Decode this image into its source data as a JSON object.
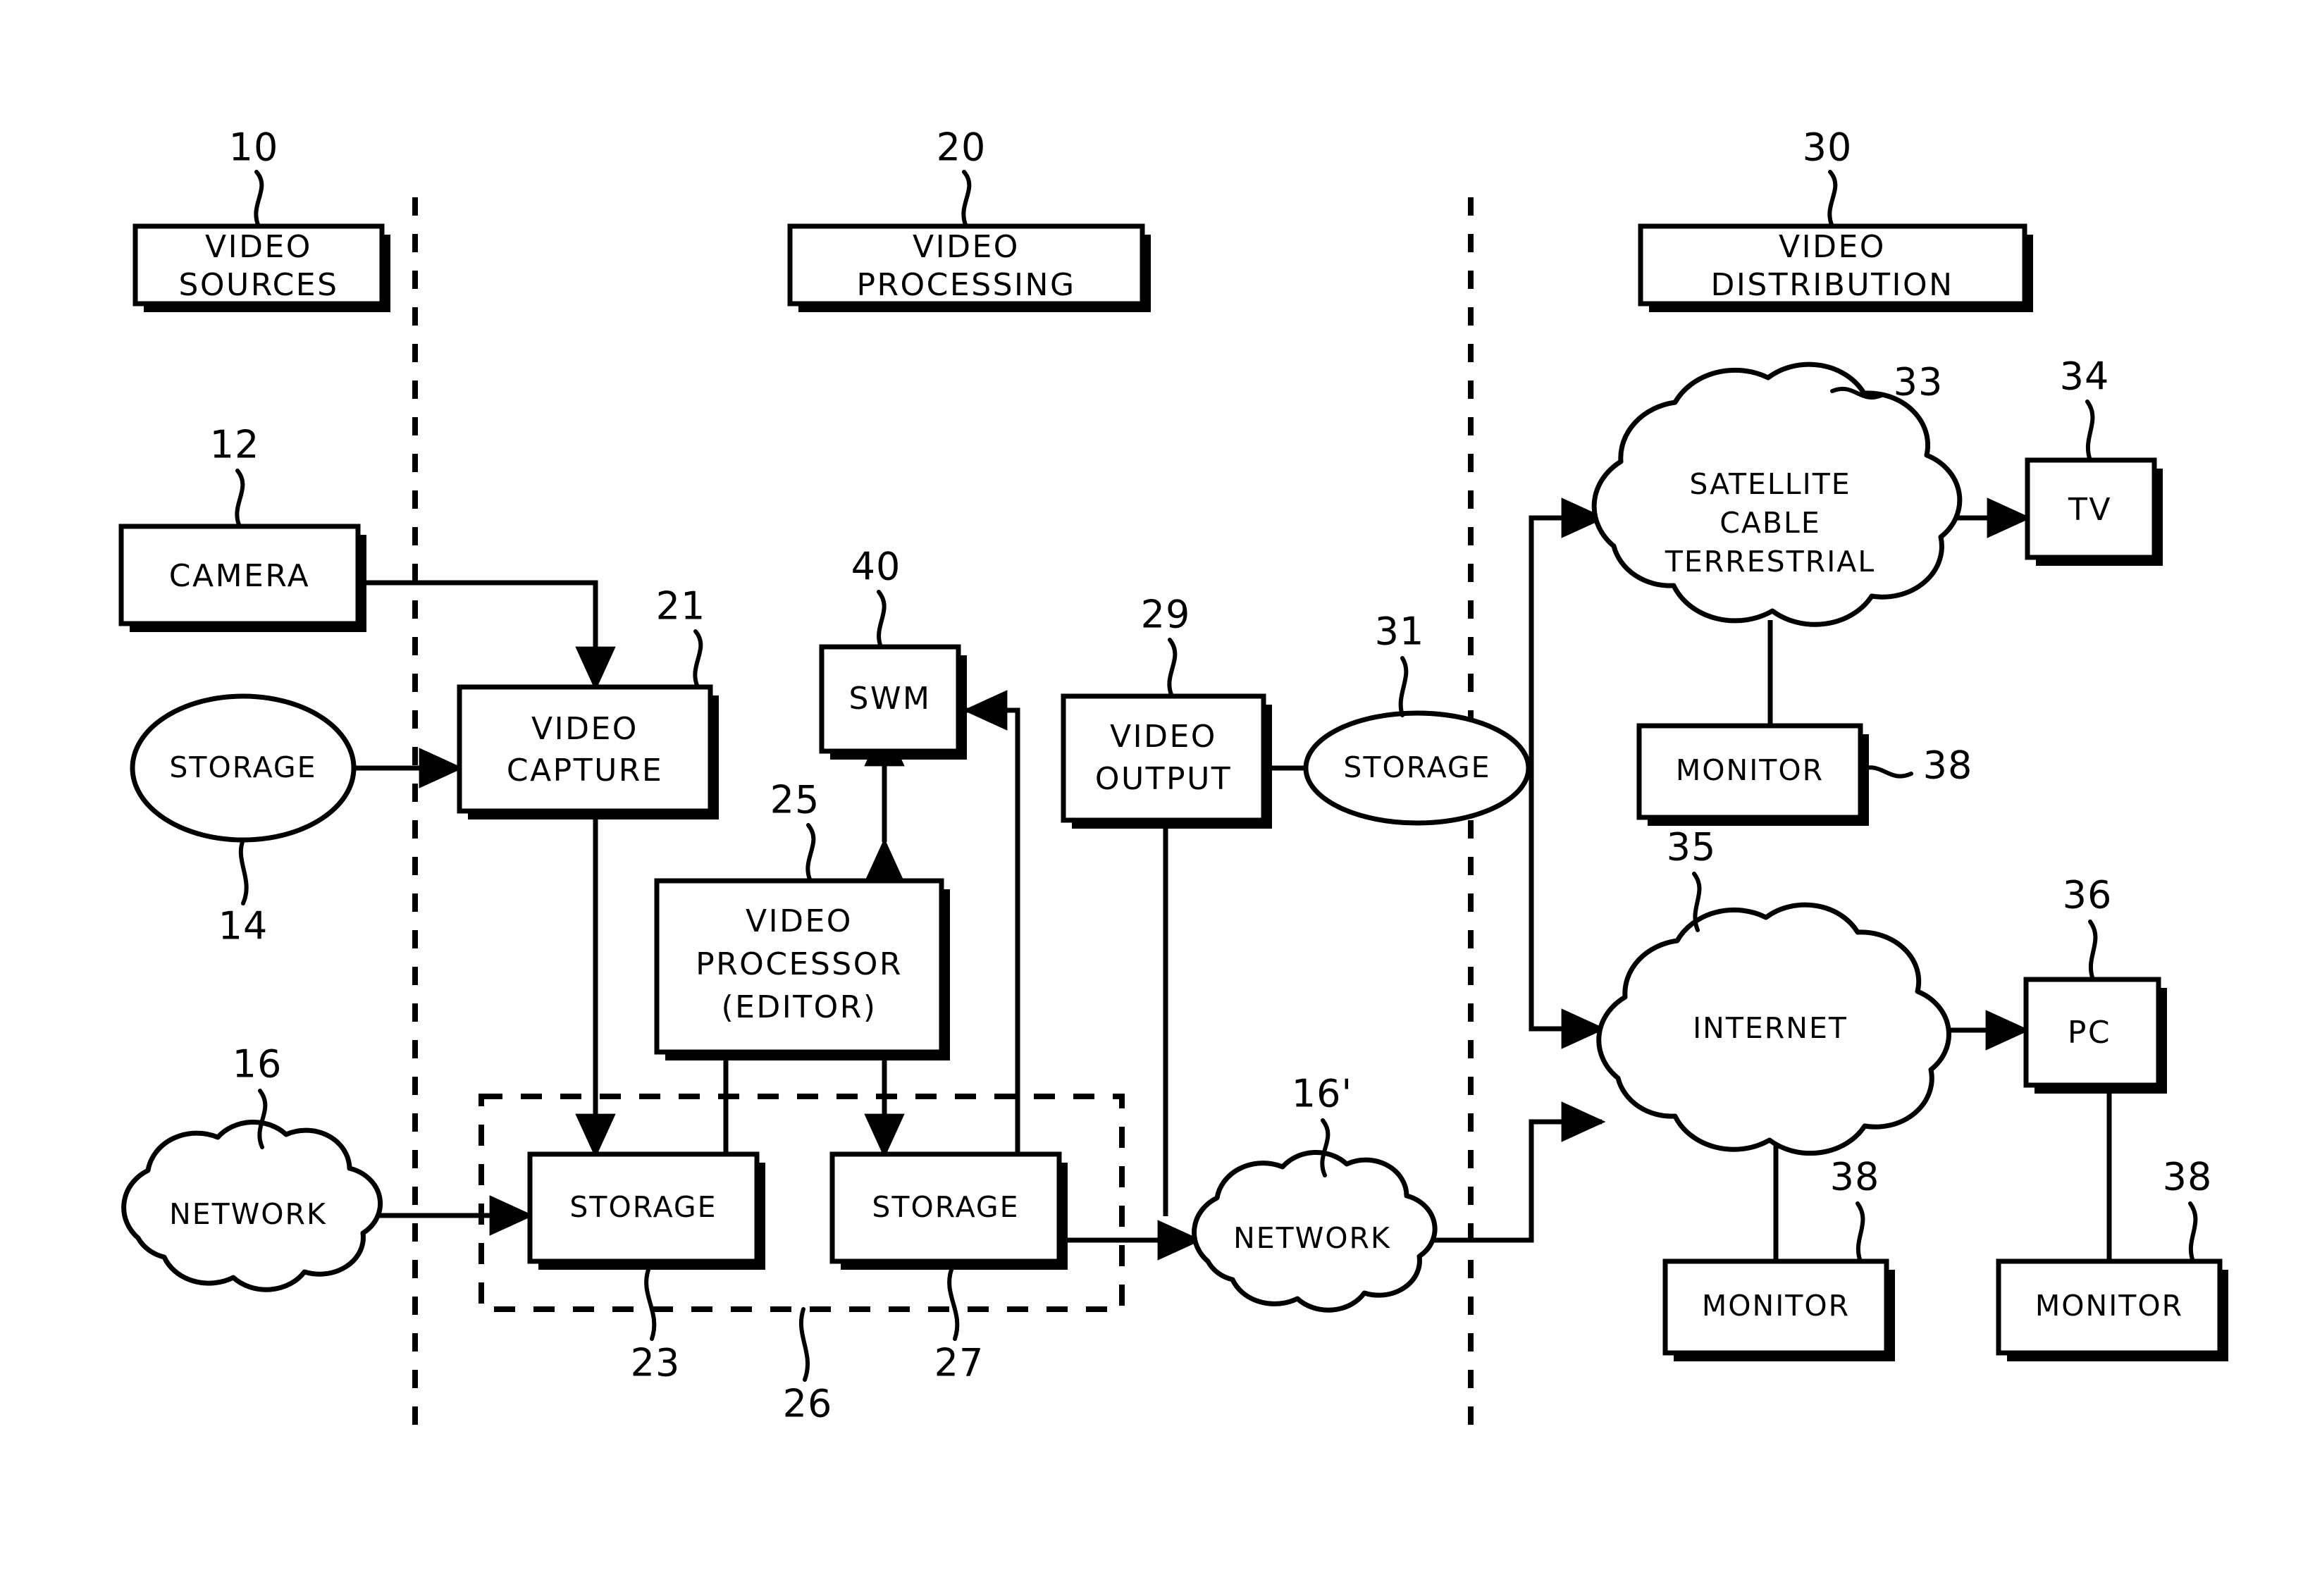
{
  "figure": {
    "type": "patent-block-diagram",
    "background_color": "#ffffff",
    "line_color": "#000000"
  },
  "sections": [
    {
      "id": "10",
      "label_line1": "VIDEO",
      "label_line2": "SOURCES",
      "ref": "10"
    },
    {
      "id": "20",
      "label_line1": "VIDEO",
      "label_line2": "PROCESSING",
      "ref": "20"
    },
    {
      "id": "30",
      "label_line1": "VIDEO",
      "label_line2": "DISTRIBUTION",
      "ref": "30"
    }
  ],
  "blocks": {
    "camera": {
      "label": "CAMERA",
      "ref": "12"
    },
    "storage14": {
      "label": "STORAGE",
      "ref": "14"
    },
    "network16": {
      "label": "NETWORK",
      "ref": "16"
    },
    "video_capture": {
      "label_line1": "VIDEO",
      "label_line2": "CAPTURE",
      "ref": "21"
    },
    "swm": {
      "label": "SWM",
      "ref": "40"
    },
    "video_processor": {
      "label_line1": "VIDEO",
      "label_line2": "PROCESSOR",
      "label_line3": "(EDITOR)",
      "ref": "25"
    },
    "storage23": {
      "label": "STORAGE",
      "ref": "23"
    },
    "storage27": {
      "label": "STORAGE",
      "ref": "27"
    },
    "storage_group": {
      "ref": "26"
    },
    "video_output": {
      "label_line1": "VIDEO",
      "label_line2": "OUTPUT",
      "ref": "29"
    },
    "storage31": {
      "label": "STORAGE",
      "ref": "31"
    },
    "network16p": {
      "label": "NETWORK",
      "ref": "16'"
    },
    "satellite_cloud": {
      "label_line1": "SATELLITE",
      "label_line2": "CABLE",
      "label_line3": "TERRESTRIAL",
      "ref": "33"
    },
    "tv": {
      "label": "TV",
      "ref": "34"
    },
    "monitor38a": {
      "label": "MONITOR",
      "ref": "38"
    },
    "internet_cloud": {
      "label": "INTERNET",
      "ref": "35"
    },
    "pc": {
      "label": "PC",
      "ref": "36"
    },
    "monitor38b": {
      "label": "MONITOR",
      "ref": "38"
    },
    "monitor38c": {
      "label": "MONITOR",
      "ref": "38"
    }
  },
  "reference_numerals": [
    "10",
    "12",
    "14",
    "16",
    "16'",
    "20",
    "21",
    "23",
    "25",
    "26",
    "27",
    "29",
    "30",
    "31",
    "33",
    "34",
    "35",
    "36",
    "38",
    "40"
  ]
}
